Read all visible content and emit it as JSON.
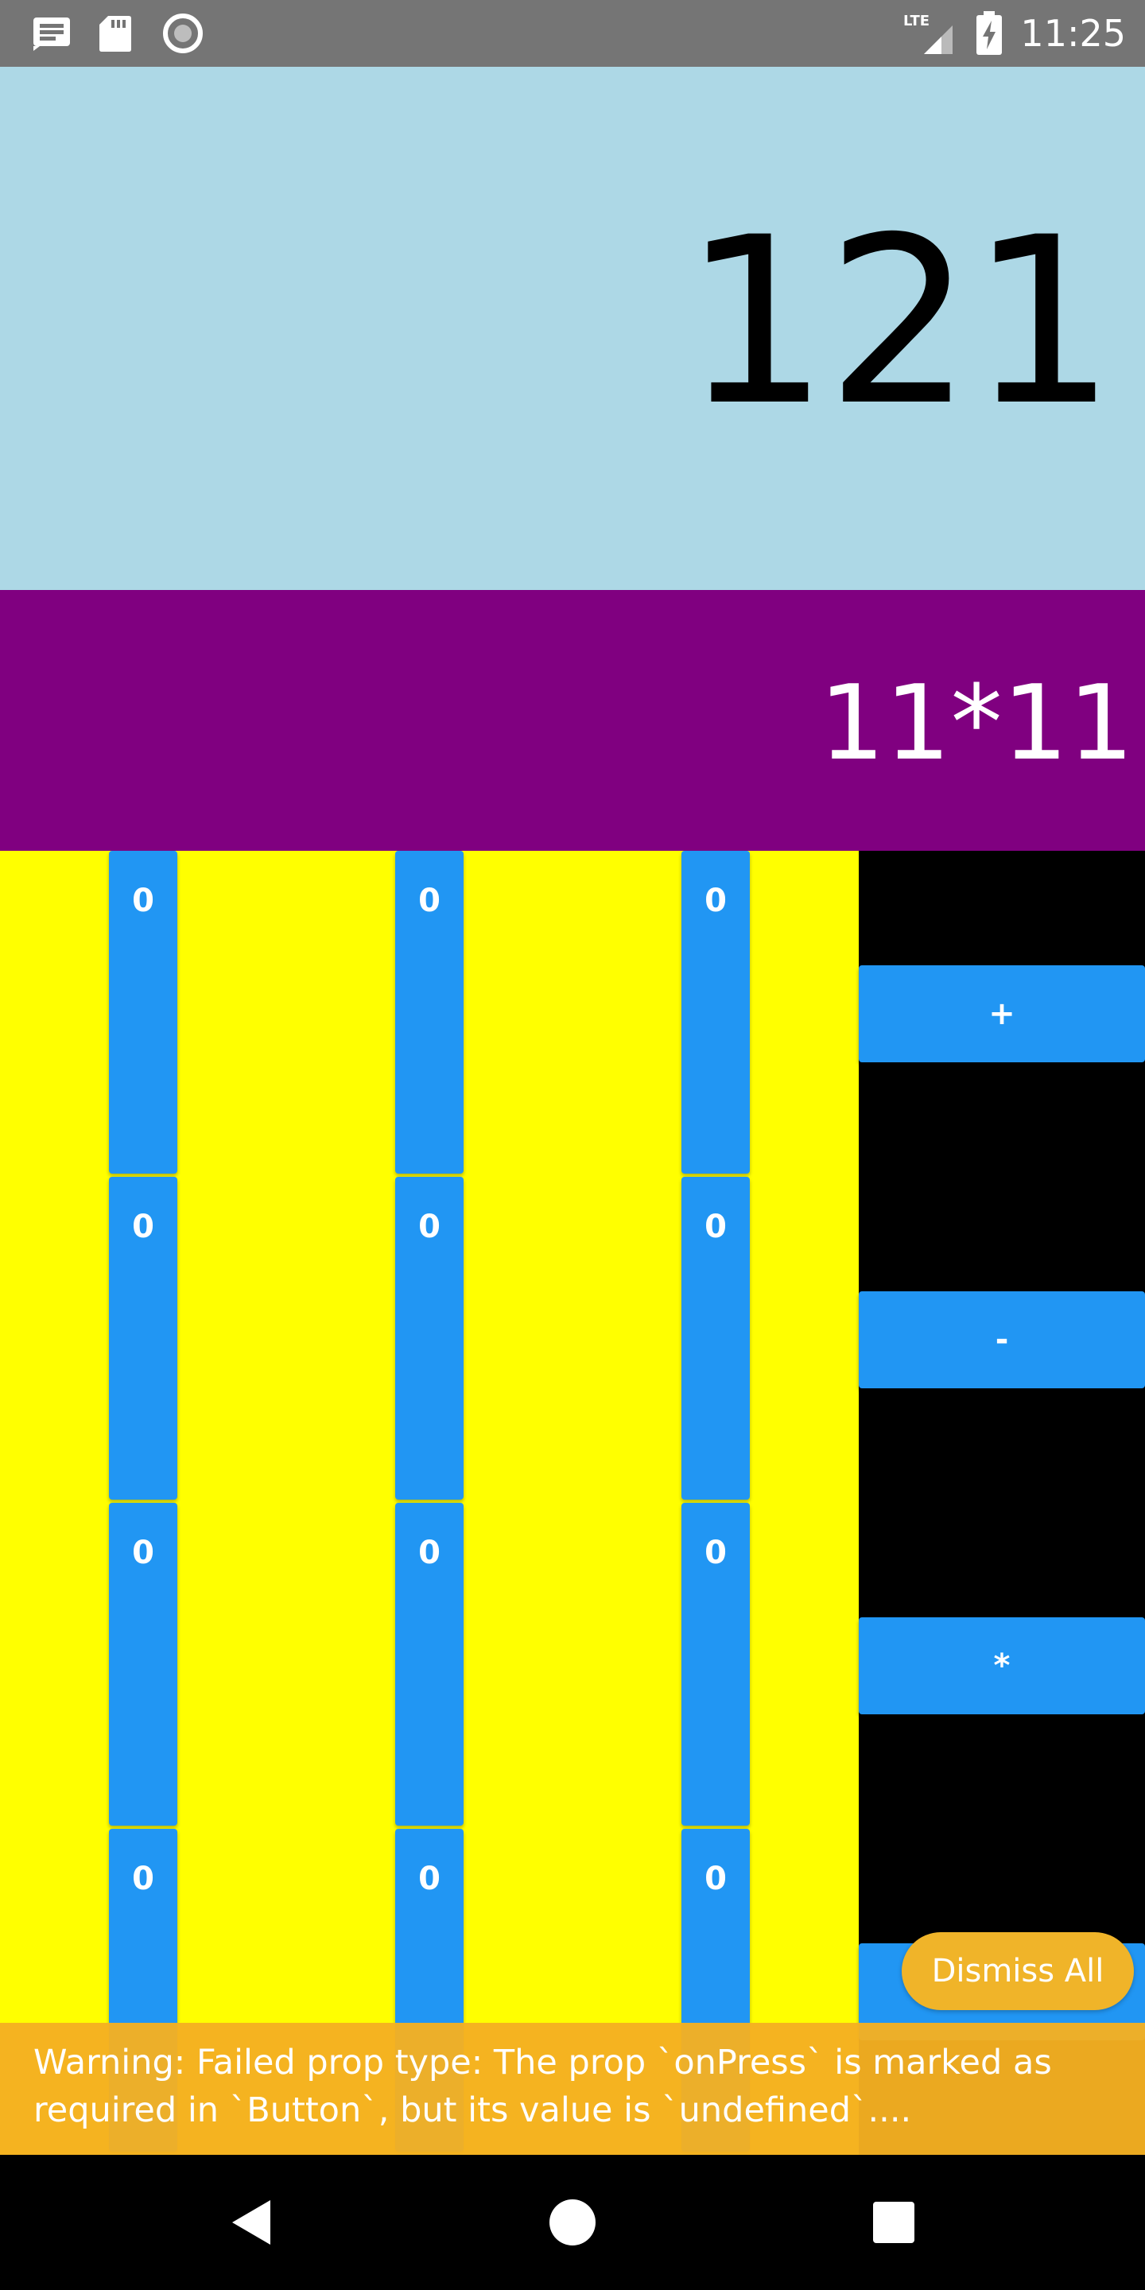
{
  "status_bar": {
    "time": "11:25",
    "network_label": "LTE",
    "icons": [
      "notification-icon",
      "sd-card-icon",
      "record-icon",
      "lte-signal-icon",
      "battery-charging-icon"
    ]
  },
  "display": {
    "result": "121",
    "expression": "11*11"
  },
  "keypad": {
    "rows": [
      [
        "0",
        "0",
        "0"
      ],
      [
        "0",
        "0",
        "0"
      ],
      [
        "0",
        "0",
        "0"
      ],
      [
        "0",
        "0",
        "0"
      ]
    ]
  },
  "operators": [
    "+",
    "-",
    "*",
    "/"
  ],
  "warning": {
    "message": "Warning: Failed prop type: The prop `onPress` is marked as required in `Button`, but its value is `undefined`....",
    "dismiss_label": "Dismiss All"
  },
  "nav_bar": {
    "icons": [
      "back-icon",
      "home-icon",
      "recents-icon"
    ]
  },
  "colors": {
    "status_bar": "#757575",
    "result_bg": "#add8e6",
    "expression_bg": "#800080",
    "keypad_bg": "#ffff00",
    "operator_bg": "#000000",
    "button": "#2196f3",
    "warning": "#f5b021"
  }
}
